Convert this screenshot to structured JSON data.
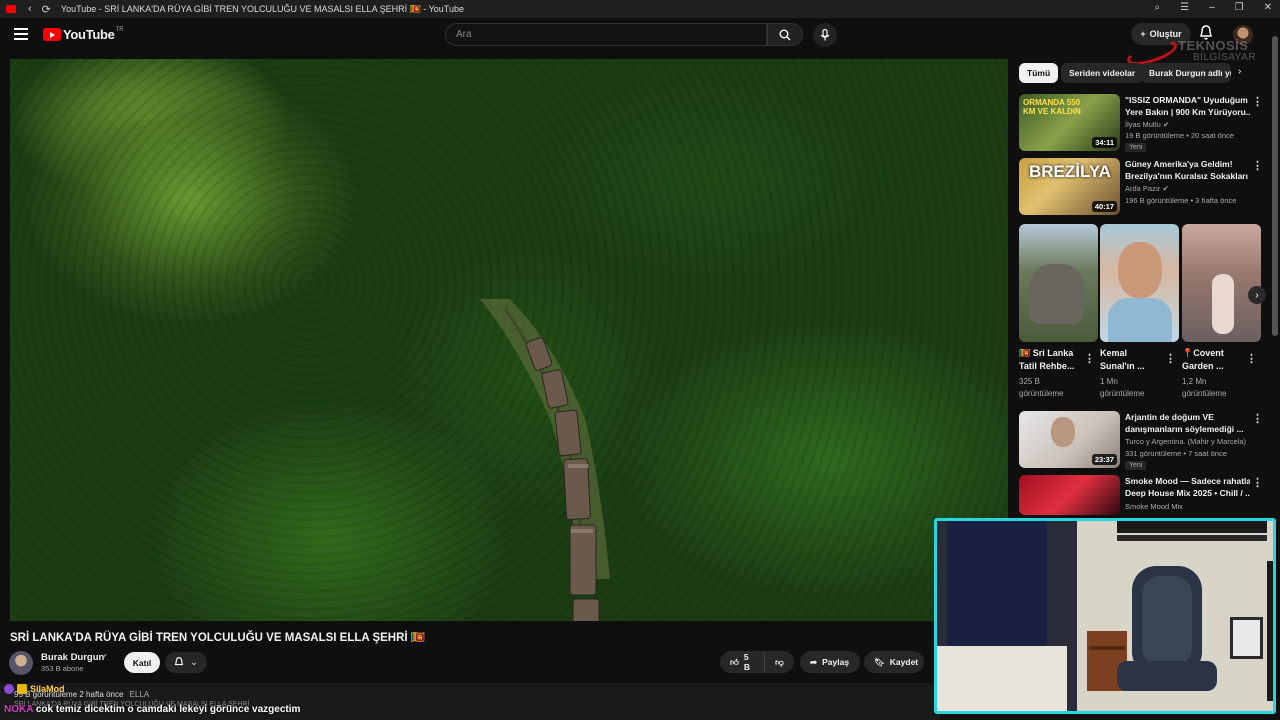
{
  "browser": {
    "tab_title": "YouTube - SRİ LANKA'DA RÜYA GİBİ TREN YOLCULUĞU VE MASALSI ELLA ŞEHRİ 🇱🇰 - YouTube"
  },
  "header": {
    "logo_text": "YouTube",
    "country_code": "TR",
    "search_placeholder": "Ara",
    "create_label": "Oluştur"
  },
  "watermark": {
    "line1": "TEKNOSİS",
    "line2": "BİLGİSAYAR"
  },
  "video": {
    "title": "SRİ LANKA'DA RÜYA GİBİ TREN YOLCULUĞU VE MASALSI ELLA ŞEHRİ 🇱🇰",
    "channel_name": "Burak Durgun",
    "subscribers": "353 B abone",
    "join_label": "Katıl",
    "like_count": "5 B",
    "share_label": "Paylaş",
    "save_label": "Kaydet"
  },
  "description": {
    "views_time": "95 B görüntüleme  2 hafta önce",
    "tag": "ELLA",
    "line2": "SRİ LANKA'DA RÜYA GİBİ TREN YOLCULUĞU VE MASALSI ELLA ŞEHRİ"
  },
  "chat": {
    "username": "SilaMod",
    "prefix": "NOKA",
    "message": "cok temiz dicektim o camdaki lekeyi görünce vazgectim"
  },
  "chips": [
    "Tümü",
    "Seriden videolar",
    "Burak Durgun adlı yükle"
  ],
  "sidebar_videos": [
    {
      "title": "\"ISSIZ ORMANDA\" Uyuduğum Yere Bakın | 900 Km Yürüyoru...",
      "title_line1": "\"ISSIZ ORMANDA\" Uyuduğum",
      "title_line2": "Yere Bakın | 900 Km Yürüyoru...",
      "channel": "İlyas Mutlu",
      "meta": "19 B görüntüleme • 20 saat önce",
      "badge": "Yeni",
      "duration": "34:11",
      "thumb_text": "ORMANDA 550 KM VE KALDIN"
    },
    {
      "title_line1": "Güney Amerika'ya Geldim!",
      "title_line2": "Brezilya'nın Kuralsız Sokakları ...",
      "channel": "Arda Pazır",
      "meta": "196 B görüntüleme • 3 hafta önce",
      "duration": "40:17",
      "thumb_text": "BREZİLYA"
    },
    {
      "title_line1": "Arjantin de doğum VE",
      "title_line2": "danışmanların söylemediği ...",
      "channel": "Turco y Argentina. (Mahir y Marcela)",
      "meta": "331 görüntüleme • 7 saat önce",
      "badge": "Yeni",
      "duration": "23:37"
    },
    {
      "title_line1": "Smoke Mood — Sadece rahatla |",
      "title_line2": "Deep House Mix 2025 • Chill / ...",
      "channel": "Smoke Mood Mix"
    }
  ],
  "shorts": [
    {
      "title_line1": "🇱🇰 Sri Lanka",
      "title_line2": "Tatil Rehbe...",
      "views_line1": "325 B",
      "views_line2": "görüntüleme"
    },
    {
      "title_line1": "Kemal",
      "title_line2": "Sunal'ın ...",
      "views_line1": "1 Mn",
      "views_line2": "görüntüleme"
    },
    {
      "title_line1": "📍Covent",
      "title_line2": "Garden ...",
      "views_line1": "1,2 Mn",
      "views_line2": "görüntüleme"
    }
  ],
  "colors": {
    "background": "#0f0f0f",
    "brand_red": "#ff0000",
    "webcam_border": "#29d6e0",
    "chat_username": "#ffd24a"
  }
}
